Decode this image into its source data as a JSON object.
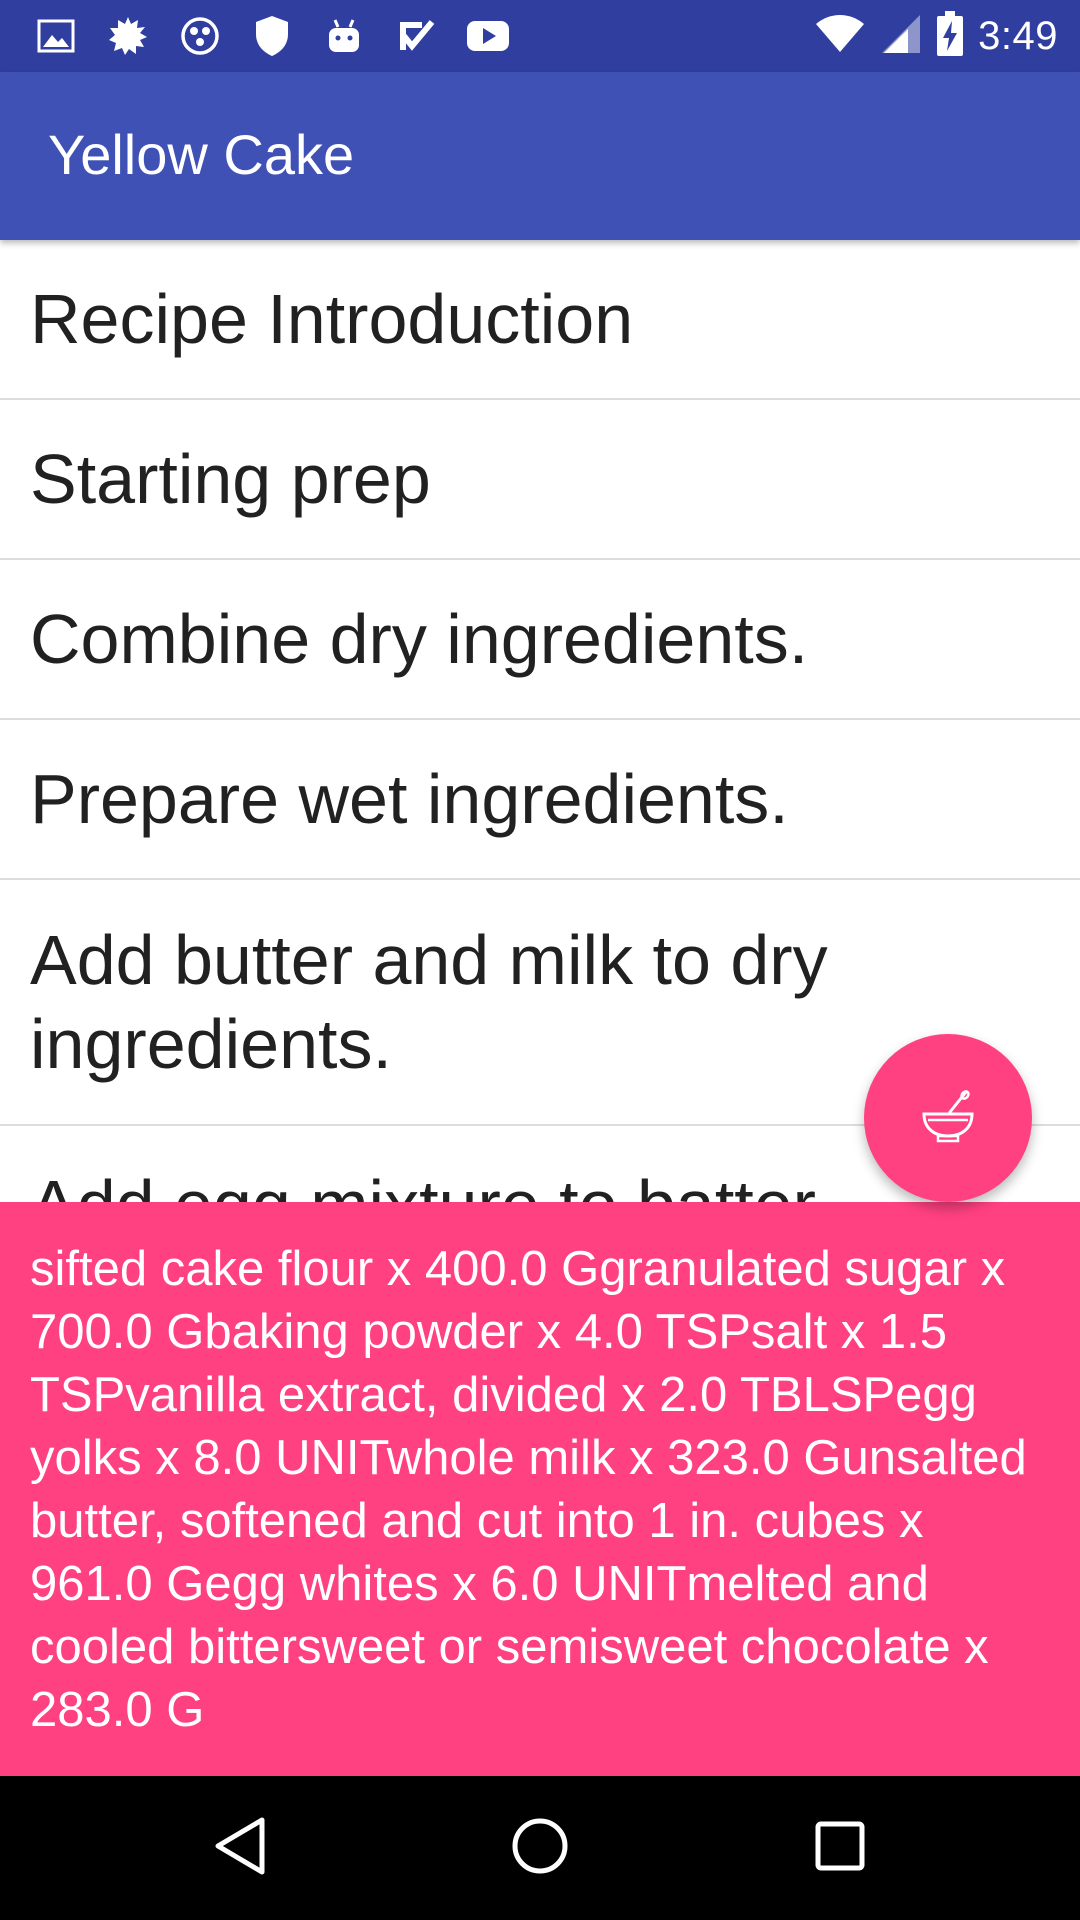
{
  "status_bar": {
    "time": "3:49",
    "icons_left": [
      "image-icon",
      "settings-burst-icon",
      "circles-icon",
      "shield-icon",
      "android-icon",
      "check-box-icon",
      "youtube-icon"
    ],
    "icons_right": [
      "wifi-icon",
      "signal-icon",
      "battery-charging-icon"
    ],
    "color": "#303f9f"
  },
  "app_bar": {
    "title": "Yellow Cake",
    "color": "#3f51b5"
  },
  "steps": [
    {
      "label": "Recipe Introduction"
    },
    {
      "label": "Starting prep"
    },
    {
      "label": "Combine dry ingredients."
    },
    {
      "label": "Prepare wet ingredients."
    },
    {
      "label": "Add butter and milk to dry ingredients."
    },
    {
      "label": "Add egg mixture to batter."
    }
  ],
  "ingredients_panel": {
    "text": "sifted cake flour x 400.0 Ggranulated sugar x 700.0 Gbaking powder x 4.0 TSPsalt x 1.5 TSPvanilla extract, divided x 2.0 TBLSPegg yolks x 8.0 UNITwhole milk x 323.0 Gunsalted butter, softened and cut into 1 in. cubes x 961.0 Gegg whites x 6.0 UNITmelted and cooled bittersweet or semisweet chocolate x 283.0 G",
    "color": "#ff4081"
  },
  "fab": {
    "icon": "mortar-pestle-icon",
    "color": "#ff4081"
  },
  "nav_bar": {
    "buttons": [
      "back-icon",
      "home-icon",
      "recents-icon"
    ]
  }
}
